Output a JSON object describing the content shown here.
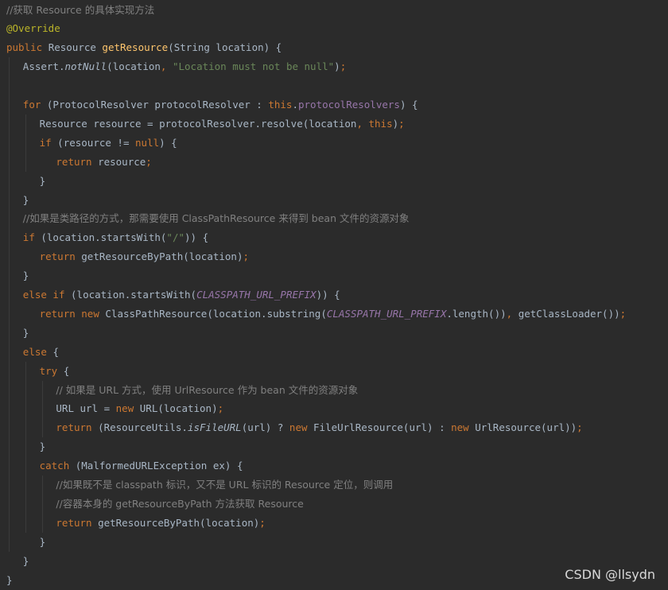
{
  "editor": {
    "colors": {
      "background": "#2b2b2b",
      "text": "#a9b7c6",
      "comment": "#808080",
      "annotation": "#bbb529",
      "keyword": "#cc7832",
      "method": "#ffc66d",
      "string": "#6a8759",
      "field": "#9876aa"
    },
    "lines": [
      {
        "indent": 0,
        "tokens": [
          {
            "t": "comment",
            "v": "//获取 Resource 的具体实现方法"
          }
        ]
      },
      {
        "indent": 0,
        "tokens": [
          {
            "t": "annot",
            "v": "@Override"
          }
        ]
      },
      {
        "indent": 0,
        "tokens": [
          {
            "t": "kw",
            "v": "public "
          },
          {
            "t": "plain",
            "v": "Resource "
          },
          {
            "t": "method",
            "v": "getResource"
          },
          {
            "t": "plain",
            "v": "(String location) {"
          }
        ]
      },
      {
        "indent": 1,
        "tokens": [
          {
            "t": "plain",
            "v": "Assert."
          },
          {
            "t": "static",
            "v": "notNull"
          },
          {
            "t": "plain",
            "v": "(location"
          },
          {
            "t": "kw",
            "v": ", "
          },
          {
            "t": "str",
            "v": "\"Location must not be null\""
          },
          {
            "t": "plain",
            "v": ")"
          },
          {
            "t": "kw",
            "v": ";"
          }
        ]
      },
      {
        "indent": 0,
        "tokens": []
      },
      {
        "indent": 1,
        "tokens": [
          {
            "t": "kw",
            "v": "for "
          },
          {
            "t": "plain",
            "v": "(ProtocolResolver protocolResolver : "
          },
          {
            "t": "kw",
            "v": "this"
          },
          {
            "t": "plain",
            "v": "."
          },
          {
            "t": "field",
            "v": "protocolResolvers"
          },
          {
            "t": "plain",
            "v": ") {"
          }
        ]
      },
      {
        "indent": 2,
        "tokens": [
          {
            "t": "plain",
            "v": "Resource resource = protocolResolver.resolve(location"
          },
          {
            "t": "kw",
            "v": ", this"
          },
          {
            "t": "plain",
            "v": ")"
          },
          {
            "t": "kw",
            "v": ";"
          }
        ]
      },
      {
        "indent": 2,
        "tokens": [
          {
            "t": "kw",
            "v": "if "
          },
          {
            "t": "plain",
            "v": "(resource != "
          },
          {
            "t": "kw",
            "v": "null"
          },
          {
            "t": "plain",
            "v": ") {"
          }
        ]
      },
      {
        "indent": 3,
        "tokens": [
          {
            "t": "kw",
            "v": "return "
          },
          {
            "t": "plain",
            "v": "resource"
          },
          {
            "t": "kw",
            "v": ";"
          }
        ]
      },
      {
        "indent": 2,
        "tokens": [
          {
            "t": "plain",
            "v": "}"
          }
        ]
      },
      {
        "indent": 1,
        "tokens": [
          {
            "t": "plain",
            "v": "}"
          }
        ]
      },
      {
        "indent": 1,
        "tokens": [
          {
            "t": "comment",
            "v": "//如果是类路径的方式，那需要使用 ClassPathResource 来得到 bean 文件的资源对象"
          }
        ]
      },
      {
        "indent": 1,
        "tokens": [
          {
            "t": "kw",
            "v": "if "
          },
          {
            "t": "plain",
            "v": "(location.startsWith("
          },
          {
            "t": "str",
            "v": "\"/\""
          },
          {
            "t": "plain",
            "v": ")) {"
          }
        ]
      },
      {
        "indent": 2,
        "tokens": [
          {
            "t": "kw",
            "v": "return "
          },
          {
            "t": "plain",
            "v": "getResourceByPath(location)"
          },
          {
            "t": "kw",
            "v": ";"
          }
        ]
      },
      {
        "indent": 1,
        "tokens": [
          {
            "t": "plain",
            "v": "}"
          }
        ]
      },
      {
        "indent": 1,
        "tokens": [
          {
            "t": "kw",
            "v": "else if "
          },
          {
            "t": "plain",
            "v": "(location.startsWith("
          },
          {
            "t": "const",
            "v": "CLASSPATH_URL_PREFIX"
          },
          {
            "t": "plain",
            "v": ")) {"
          }
        ]
      },
      {
        "indent": 2,
        "tokens": [
          {
            "t": "kw",
            "v": "return new "
          },
          {
            "t": "plain",
            "v": "ClassPathResource(location.substring("
          },
          {
            "t": "const",
            "v": "CLASSPATH_URL_PREFIX"
          },
          {
            "t": "plain",
            "v": ".length())"
          },
          {
            "t": "kw",
            "v": ", "
          },
          {
            "t": "plain",
            "v": "getClassLoader())"
          },
          {
            "t": "kw",
            "v": ";"
          }
        ]
      },
      {
        "indent": 1,
        "tokens": [
          {
            "t": "plain",
            "v": "}"
          }
        ]
      },
      {
        "indent": 1,
        "tokens": [
          {
            "t": "kw",
            "v": "else "
          },
          {
            "t": "plain",
            "v": "{"
          }
        ]
      },
      {
        "indent": 2,
        "tokens": [
          {
            "t": "kw",
            "v": "try "
          },
          {
            "t": "plain",
            "v": "{"
          }
        ]
      },
      {
        "indent": 3,
        "tokens": [
          {
            "t": "comment",
            "v": "// 如果是 URL 方式，使用 UrlResource 作为 bean 文件的资源对象"
          }
        ]
      },
      {
        "indent": 3,
        "tokens": [
          {
            "t": "plain",
            "v": "URL url = "
          },
          {
            "t": "kw",
            "v": "new "
          },
          {
            "t": "plain",
            "v": "URL(location)"
          },
          {
            "t": "kw",
            "v": ";"
          }
        ]
      },
      {
        "indent": 3,
        "tokens": [
          {
            "t": "kw",
            "v": "return "
          },
          {
            "t": "plain",
            "v": "(ResourceUtils."
          },
          {
            "t": "static",
            "v": "isFileURL"
          },
          {
            "t": "plain",
            "v": "(url) ? "
          },
          {
            "t": "kw",
            "v": "new "
          },
          {
            "t": "plain",
            "v": "FileUrlResource(url) : "
          },
          {
            "t": "kw",
            "v": "new "
          },
          {
            "t": "plain",
            "v": "UrlResource(url))"
          },
          {
            "t": "kw",
            "v": ";"
          }
        ]
      },
      {
        "indent": 2,
        "tokens": [
          {
            "t": "plain",
            "v": "}"
          }
        ]
      },
      {
        "indent": 2,
        "tokens": [
          {
            "t": "kw",
            "v": "catch "
          },
          {
            "t": "plain",
            "v": "(MalformedURLException ex) {"
          }
        ]
      },
      {
        "indent": 3,
        "tokens": [
          {
            "t": "comment",
            "v": "//如果既不是 classpath 标识，又不是 URL 标识的 Resource 定位，则调用"
          }
        ]
      },
      {
        "indent": 3,
        "tokens": [
          {
            "t": "comment",
            "v": "//容器本身的 getResourceByPath 方法获取 Resource"
          }
        ]
      },
      {
        "indent": 3,
        "tokens": [
          {
            "t": "kw",
            "v": "return "
          },
          {
            "t": "plain",
            "v": "getResourceByPath(location)"
          },
          {
            "t": "kw",
            "v": ";"
          }
        ]
      },
      {
        "indent": 2,
        "tokens": [
          {
            "t": "plain",
            "v": "}"
          }
        ]
      },
      {
        "indent": 1,
        "tokens": [
          {
            "t": "plain",
            "v": "}"
          }
        ]
      },
      {
        "indent": 0,
        "tokens": [
          {
            "t": "plain",
            "v": "}"
          }
        ]
      }
    ]
  },
  "watermark": "CSDN @llsydn"
}
